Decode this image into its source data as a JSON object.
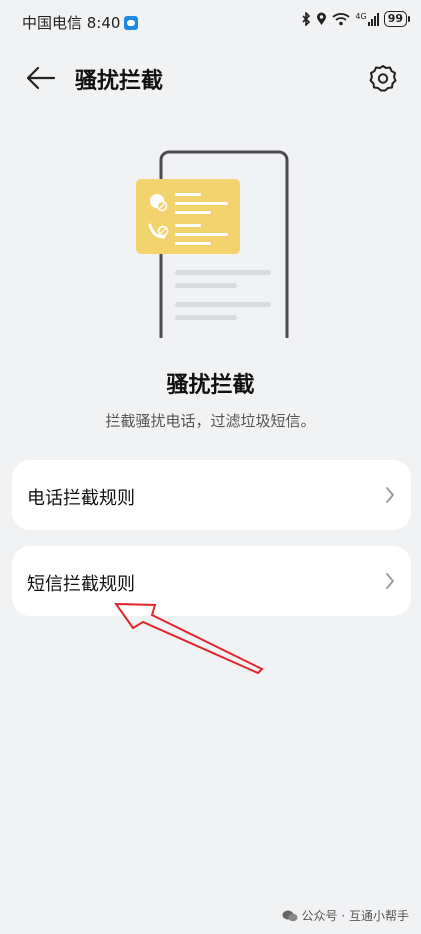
{
  "status_bar": {
    "carrier": "中国电信 8:40",
    "network": "4G",
    "battery": "99"
  },
  "header": {
    "title": "骚扰拦截"
  },
  "hero": {
    "title": "骚扰拦截",
    "subtitle": "拦截骚扰电话，过滤垃圾短信。"
  },
  "rules": [
    {
      "label": "电话拦截规则"
    },
    {
      "label": "短信拦截规则"
    }
  ],
  "watermark": {
    "text": "公众号 · 互通小帮手"
  },
  "colors": {
    "background": "#f1f2f4",
    "card": "#ffffff",
    "illustration_accent": "#f2d36e",
    "annotation_arrow": "#e0252b"
  },
  "icons": [
    "back-arrow-icon",
    "gear-icon",
    "chevron-right-icon",
    "bluetooth-icon",
    "location-icon",
    "wifi-icon",
    "signal-icon",
    "battery-icon",
    "wechat-icon"
  ]
}
